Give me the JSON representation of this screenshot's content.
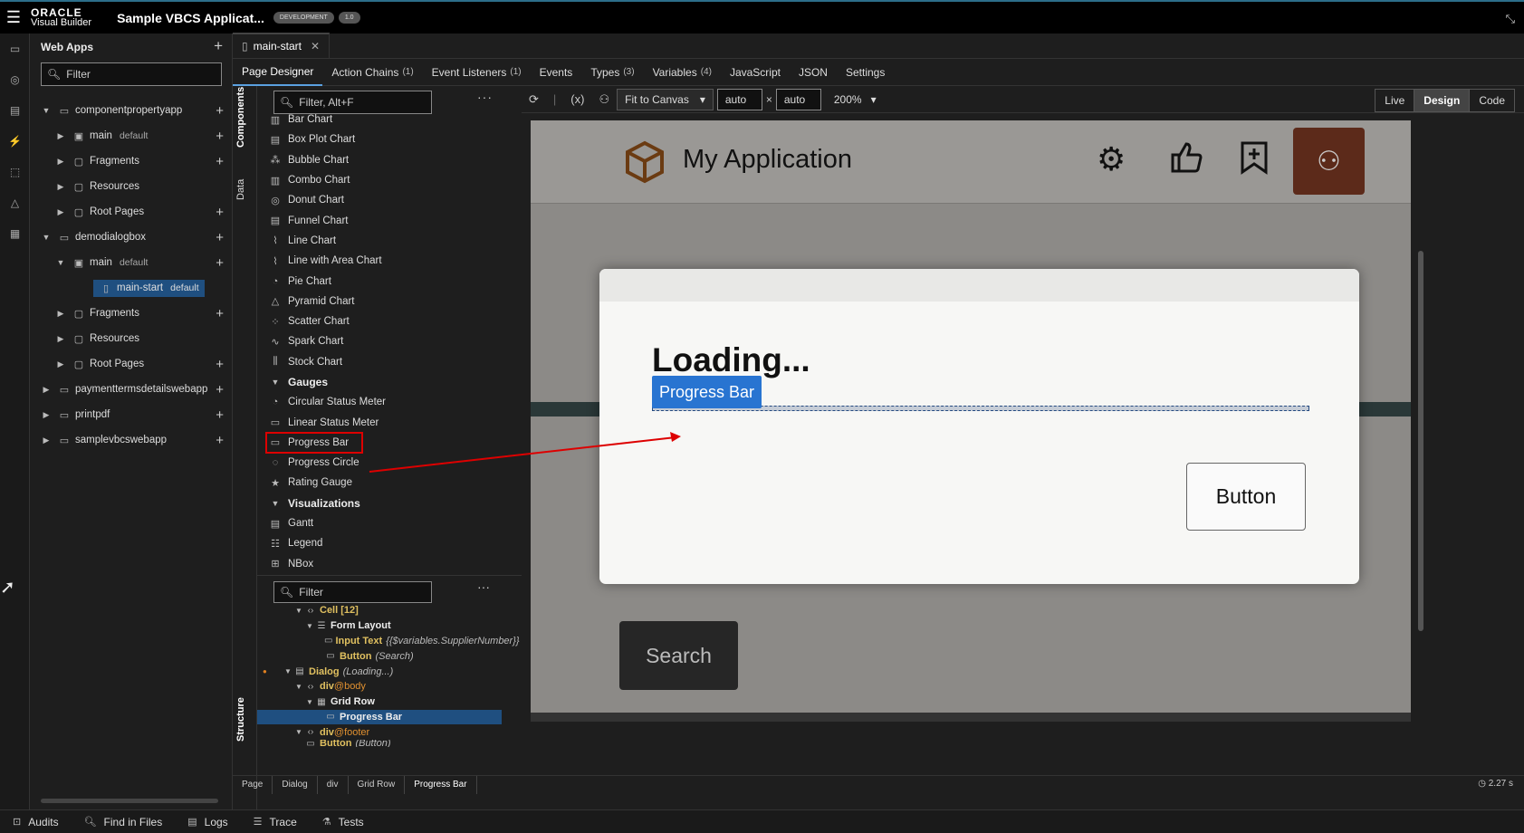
{
  "topbar": {
    "brand_line1": "ORACLE",
    "brand_line2": "Visual Builder",
    "app_title": "Sample VBCS Applicat...",
    "badge_env": "DEVELOPMENT",
    "badge_version": "1.0"
  },
  "nav": {
    "header": "Web Apps",
    "filter_placeholder": "Filter",
    "tree": [
      {
        "label": "componentpropertyapp"
      },
      {
        "label": "main",
        "tag": "default"
      },
      {
        "label": "Fragments"
      },
      {
        "label": "Resources"
      },
      {
        "label": "Root Pages"
      },
      {
        "label": "demodialogbox"
      },
      {
        "label": "main",
        "tag": "default"
      },
      {
        "label": "main-start",
        "tag": "default"
      },
      {
        "label": "Fragments"
      },
      {
        "label": "Resources"
      },
      {
        "label": "Root Pages"
      },
      {
        "label": "paymenttermsdetailswebapp"
      },
      {
        "label": "printpdf"
      },
      {
        "label": "samplevbcswebapp"
      }
    ]
  },
  "editor": {
    "file_tab": "main-start",
    "subtabs": [
      {
        "label": "Page Designer",
        "count": ""
      },
      {
        "label": "Action Chains",
        "count": "(1)"
      },
      {
        "label": "Event Listeners",
        "count": "(1)"
      },
      {
        "label": "Events",
        "count": ""
      },
      {
        "label": "Types",
        "count": "(3)"
      },
      {
        "label": "Variables",
        "count": "(4)"
      },
      {
        "label": "JavaScript",
        "count": ""
      },
      {
        "label": "JSON",
        "count": ""
      },
      {
        "label": "Settings",
        "count": ""
      }
    ],
    "vtabs": {
      "components": "Components",
      "data": "Data",
      "structure": "Structure"
    }
  },
  "components": {
    "filter_placeholder": "Filter, Alt+F",
    "items": [
      {
        "label": "Bar Chart"
      },
      {
        "label": "Box Plot Chart"
      },
      {
        "label": "Bubble Chart"
      },
      {
        "label": "Combo Chart"
      },
      {
        "label": "Donut Chart"
      },
      {
        "label": "Funnel Chart"
      },
      {
        "label": "Line Chart"
      },
      {
        "label": "Line with Area Chart"
      },
      {
        "label": "Pie Chart"
      },
      {
        "label": "Pyramid Chart"
      },
      {
        "label": "Scatter Chart"
      },
      {
        "label": "Spark Chart"
      },
      {
        "label": "Stock Chart"
      }
    ],
    "group_gauges": "Gauges",
    "gauges": [
      {
        "label": "Circular Status Meter"
      },
      {
        "label": "Linear Status Meter"
      },
      {
        "label": "Progress Bar"
      },
      {
        "label": "Progress Circle"
      },
      {
        "label": "Rating Gauge"
      }
    ],
    "group_visualizations": "Visualizations",
    "visualizations": [
      {
        "label": "Gantt"
      },
      {
        "label": "Legend"
      },
      {
        "label": "NBox"
      }
    ]
  },
  "structure": {
    "filter_placeholder": "Filter",
    "rows": [
      {
        "label": "Cell [12]",
        "extra": ""
      },
      {
        "label": "Form Layout",
        "extra": ""
      },
      {
        "label": "Input Text",
        "extra": "{{$variables.SupplierNumber}}"
      },
      {
        "label": "Button",
        "extra": "(Search)"
      },
      {
        "label": "Dialog",
        "extra": "(Loading...)"
      },
      {
        "label": "div",
        "extra": "@body"
      },
      {
        "label": "Grid Row",
        "extra": ""
      },
      {
        "label": "Progress Bar",
        "extra": ""
      },
      {
        "label": "div",
        "extra": "@footer"
      },
      {
        "label": "Button",
        "extra": "(Button)"
      }
    ]
  },
  "canvasbar": {
    "fit": "Fit to Canvas",
    "width": "auto",
    "height": "auto",
    "times": "×",
    "zoom": "200%",
    "modes": [
      "Live",
      "Design",
      "Code"
    ]
  },
  "preview": {
    "app_name": "My Application",
    "dialog_title": "Loading...",
    "progress_tag": "Progress Bar",
    "progress_value": null,
    "dialog_button": "Button",
    "search_button": "Search"
  },
  "breadcrumb": [
    "Page",
    "Dialog",
    "div",
    "Grid Row",
    "Progress Bar"
  ],
  "timer": "2.27 s",
  "statusbar": [
    "Audits",
    "Find in Files",
    "Logs",
    "Trace",
    "Tests"
  ]
}
